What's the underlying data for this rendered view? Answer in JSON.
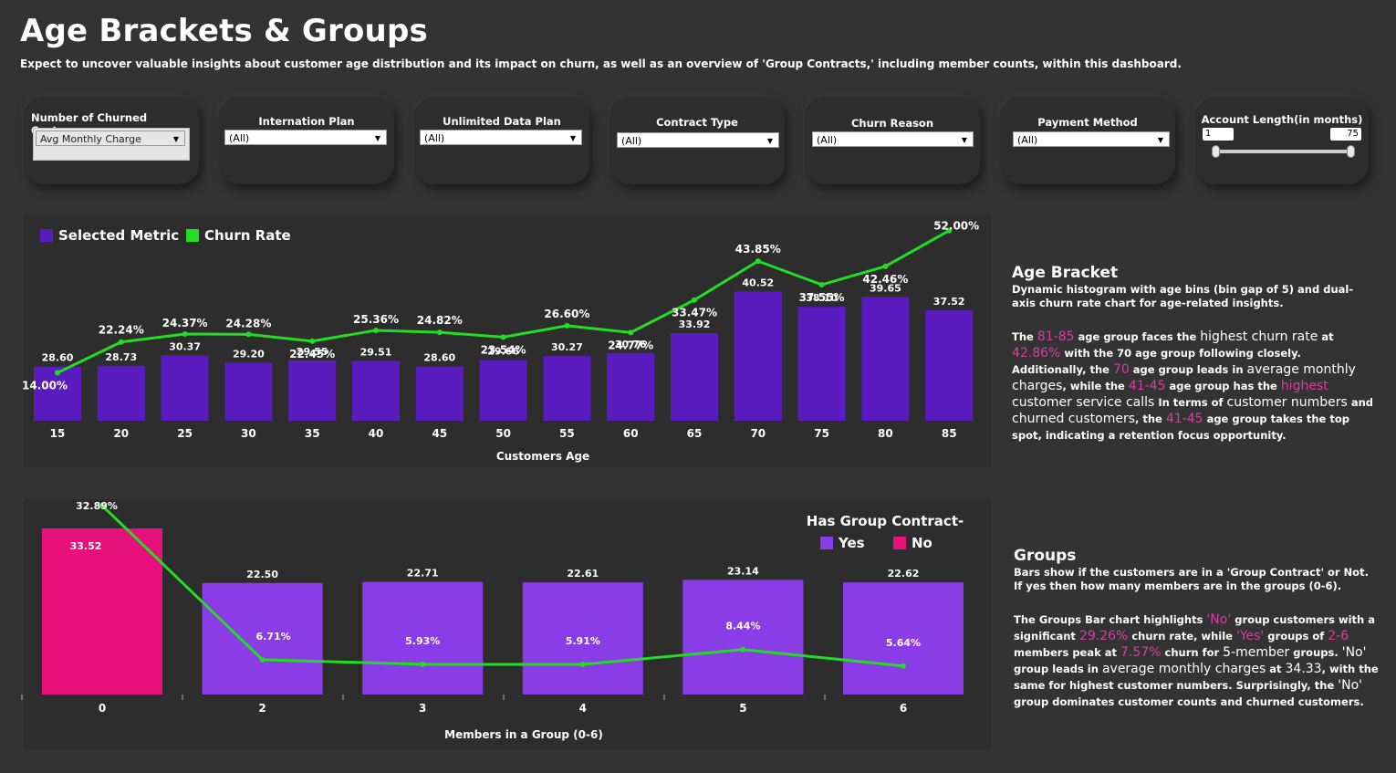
{
  "header": {
    "title": "Age Brackets & Groups",
    "subtitle": "Expect to uncover valuable insights about customer age distribution and its impact on churn, as well as an overview of 'Group Contracts,' including member counts, within this dashboard."
  },
  "filters": {
    "metric": {
      "label": "Number of Churned Customers",
      "value": "Avg Monthly Charge"
    },
    "international_plan": {
      "label": "Internation Plan",
      "value": "(All)"
    },
    "unlimited_data_plan": {
      "label": "Unlimited Data Plan",
      "value": "(All)"
    },
    "contract_type": {
      "label": "Contract Type",
      "value": "(All)"
    },
    "churn_reason": {
      "label": "Churn Reason",
      "value": "(All)"
    },
    "payment_method": {
      "label": "Payment Method",
      "value": "(All)"
    },
    "account_length": {
      "label": "Account Length(in months)",
      "min": "1",
      "max": "75"
    }
  },
  "notes": {
    "age_title": "Age Bracket",
    "age_desc": "Dynamic histogram with age bins (bin gap of 5) and dual-axis churn rate chart for age-related insights.",
    "age_p": [
      "The ",
      "81-85",
      " age group faces the ",
      "highest churn rate",
      " at ",
      "42.86%",
      "  with the 70 age group following closely. Additionally, the ",
      "70",
      " age group leads in ",
      "average monthly charges",
      ", while the ",
      "41-45",
      " age group has the ",
      "highest",
      " ",
      "customer service calls",
      "  In terms of ",
      "customer numbers",
      " and ",
      "churned customers",
      ", the ",
      "41-45",
      " age group takes the top spot, indicating a retention focus opportunity."
    ],
    "groups_title": "Groups",
    "groups_desc": "Bars show if the customers are in a 'Group Contract' or Not. If yes then how many members are in the groups (0-6).",
    "groups_p": [
      "The Groups Bar chart highlights ",
      "'No'",
      " group customers with a significant ",
      "29.26%",
      " churn rate, while ",
      "'Yes'",
      " groups of ",
      "2-6",
      " members peak at ",
      "7.57%",
      " churn for ",
      "5-member",
      " groups. ",
      "'No'",
      " group leads in ",
      "average monthly charges",
      " at ",
      "34.33",
      ", with the same for highest customer numbers. Surprisingly, the ",
      "'No'",
      " group dominates customer counts and churned customers."
    ]
  },
  "chart_data": [
    {
      "type": "bar",
      "legend": [
        "Selected Metric",
        "Churn Rate"
      ],
      "xlabel": "Customers Age",
      "categories": [
        "15",
        "20",
        "25",
        "30",
        "35",
        "40",
        "45",
        "50",
        "55",
        "60",
        "65",
        "70",
        "75",
        "80",
        "85"
      ],
      "series": [
        {
          "name": "Selected Metric",
          "values": [
            28.6,
            28.73,
            30.37,
            29.2,
            29.55,
            29.51,
            28.6,
            29.66,
            30.27,
            30.76,
            33.92,
            40.52,
            38.1,
            39.65,
            37.52
          ],
          "labels": [
            "28.60",
            "28.73",
            "30.37",
            "29.20",
            "29.55",
            "29.51",
            "28.60",
            "29.66",
            "30.27",
            "30.76",
            "33.92",
            "40.52",
            "38.10",
            "39.65",
            "37.52"
          ]
        },
        {
          "name": "Churn Rate",
          "values": [
            14.0,
            22.24,
            24.37,
            24.28,
            22.45,
            25.36,
            24.82,
            23.54,
            26.6,
            24.77,
            33.47,
            43.85,
            37.55,
            42.46,
            52.0
          ],
          "labels": [
            "14.00%",
            "22.24%",
            "24.37%",
            "24.28%",
            "22.45%",
            "25.36%",
            "24.82%",
            "23.54%",
            "26.60%",
            "24.77%",
            "33.47%",
            "43.85%",
            "37.55%",
            "42.46%",
            "52.00%"
          ]
        }
      ],
      "colors": {
        "bar": "#5a1bbf",
        "line": "#22dd22"
      }
    },
    {
      "type": "bar",
      "legend_title": "Has Group Contract-",
      "legend": [
        "Yes",
        "No"
      ],
      "xlabel": "Members in a Group (0-6)",
      "categories": [
        "0",
        "2",
        "3",
        "4",
        "5",
        "6"
      ],
      "series": [
        {
          "name": "Selected Metric",
          "values": [
            33.52,
            22.5,
            22.71,
            22.61,
            23.14,
            22.62
          ],
          "labels": [
            "33.52",
            "22.50",
            "22.71",
            "22.61",
            "23.14",
            "22.62"
          ],
          "group": [
            "No",
            "Yes",
            "Yes",
            "Yes",
            "Yes",
            "Yes"
          ]
        },
        {
          "name": "Churn Rate",
          "values": [
            32.89,
            6.71,
            5.93,
            5.91,
            8.44,
            5.64
          ],
          "labels": [
            "32.89%",
            "6.71%",
            "5.93%",
            "5.91%",
            "8.44%",
            "5.64%"
          ]
        }
      ],
      "colors": {
        "yes": "#8a3de6",
        "no": "#e8107a",
        "line": "#22dd22"
      }
    }
  ]
}
